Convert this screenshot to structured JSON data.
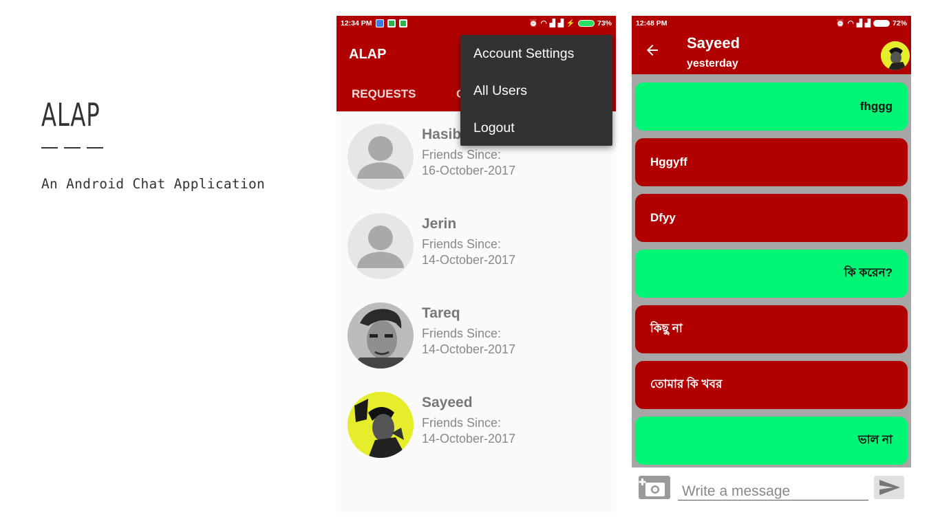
{
  "slide": {
    "title": "ALAP",
    "subtitle": "An Android Chat Application"
  },
  "phone1": {
    "status_time": "12:34 PM",
    "battery": "73%",
    "app_title": "ALAP",
    "tabs": [
      "REQUESTS",
      "C"
    ],
    "menu": [
      "Account Settings",
      "All Users",
      "Logout"
    ],
    "friends": [
      {
        "name": "Hasib",
        "since_label": "Friends Since:",
        "date": "16-October-2017",
        "avatar": "default-person-icon"
      },
      {
        "name": "Jerin",
        "since_label": "Friends Since:",
        "date": "14-October-2017",
        "avatar": "default-person-icon"
      },
      {
        "name": "Tareq",
        "since_label": "Friends Since:",
        "date": "14-October-2017",
        "avatar": "photo"
      },
      {
        "name": "Sayeed",
        "since_label": "Friends Since:",
        "date": "14-October-2017",
        "avatar": "photo"
      }
    ]
  },
  "phone2": {
    "status_time": "12:48 PM",
    "battery": "72%",
    "contact_name": "Sayeed",
    "last_seen": "yesterday",
    "messages": [
      {
        "text": "fhggg",
        "dir": "out"
      },
      {
        "text": "Hggyff",
        "dir": "in"
      },
      {
        "text": "Dfyy",
        "dir": "in"
      },
      {
        "text": "কি করেন?",
        "dir": "out"
      },
      {
        "text": "কিছু না",
        "dir": "in"
      },
      {
        "text": "তোমার কি খবর",
        "dir": "in"
      },
      {
        "text": "ভাল না",
        "dir": "out"
      }
    ],
    "input_placeholder": "Write a message"
  },
  "colors": {
    "primary": "#b00000",
    "outgoing": "#00f574",
    "menu_bg": "#323232"
  }
}
